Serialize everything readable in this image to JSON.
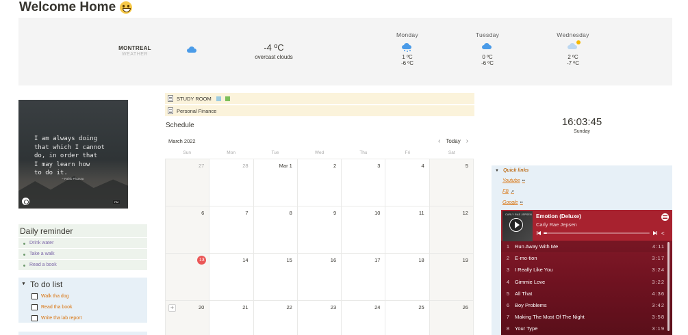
{
  "page": {
    "title": "Welcome Home"
  },
  "weather": {
    "city": "MONTREAL",
    "subtitle": "WEATHER",
    "temp": "-4 ºC",
    "description": "overcast clouds",
    "icon": "cloud-icon",
    "forecast": [
      {
        "day": "Monday",
        "hi": "1 ºC",
        "lo": "-6 ºC",
        "icon": "snow-cloud-icon"
      },
      {
        "day": "Tuesday",
        "hi": "0 ºC",
        "lo": "-6 ºC",
        "icon": "cloud-icon"
      },
      {
        "day": "Wednesday",
        "hi": "2 ºC",
        "lo": "-7 ºC",
        "icon": "partly-cloudy-icon"
      }
    ]
  },
  "quote": {
    "text": "I am always doing\nthat which I cannot\ndo, in order that\nI may learn how\nto do it.",
    "author": "~ Pablo Picasso"
  },
  "reminder": {
    "title": "Daily reminder",
    "items": [
      "Drink water",
      "Take a walk",
      "Read a book"
    ]
  },
  "todo": {
    "title": "To do list",
    "items": [
      "Walk tha dog",
      "Read tha book",
      "Write tha lab report"
    ]
  },
  "links": [
    {
      "label": "STUDY ROOM"
    },
    {
      "label": "Personal Finance"
    }
  ],
  "schedule": {
    "title": "Schedule",
    "month": "March 2022",
    "today_label": "Today",
    "weekdays": [
      "Sun",
      "Mon",
      "Tue",
      "Wed",
      "Thu",
      "Fri",
      "Sat"
    ],
    "days": [
      "27",
      "28",
      "Mar 1",
      "2",
      "3",
      "4",
      "5",
      "6",
      "7",
      "8",
      "9",
      "10",
      "11",
      "12",
      "13",
      "14",
      "15",
      "16",
      "17",
      "18",
      "19",
      "20",
      "21",
      "22",
      "23",
      "24",
      "25",
      "26"
    ],
    "today": "13"
  },
  "clock": {
    "time": "16:03:45",
    "day": "Sunday"
  },
  "quick_links": {
    "title": "Quick links",
    "items": [
      {
        "label": "Youtube",
        "suffix": "••"
      },
      {
        "label": "FB",
        "suffix": "↗"
      },
      {
        "label": "Google",
        "suffix": "••"
      }
    ]
  },
  "player": {
    "album": "Emotion (Deluxe)",
    "artist": "Carly Rae Jepsen",
    "progress": 0.03,
    "tracks": [
      {
        "n": "1",
        "title": "Run Away With Me",
        "dur": "4:11"
      },
      {
        "n": "2",
        "title": "E·mo·tion",
        "dur": "3:17"
      },
      {
        "n": "3",
        "title": "I Really Like You",
        "dur": "3:24"
      },
      {
        "n": "4",
        "title": "Gimmie Love",
        "dur": "3:22"
      },
      {
        "n": "5",
        "title": "All That",
        "dur": "4:36"
      },
      {
        "n": "6",
        "title": "Boy Problems",
        "dur": "3:42"
      },
      {
        "n": "7",
        "title": "Making The Most Of The Night",
        "dur": "3:58"
      },
      {
        "n": "8",
        "title": "Your Type",
        "dur": "3:19"
      }
    ],
    "accent": "#a8222f"
  }
}
